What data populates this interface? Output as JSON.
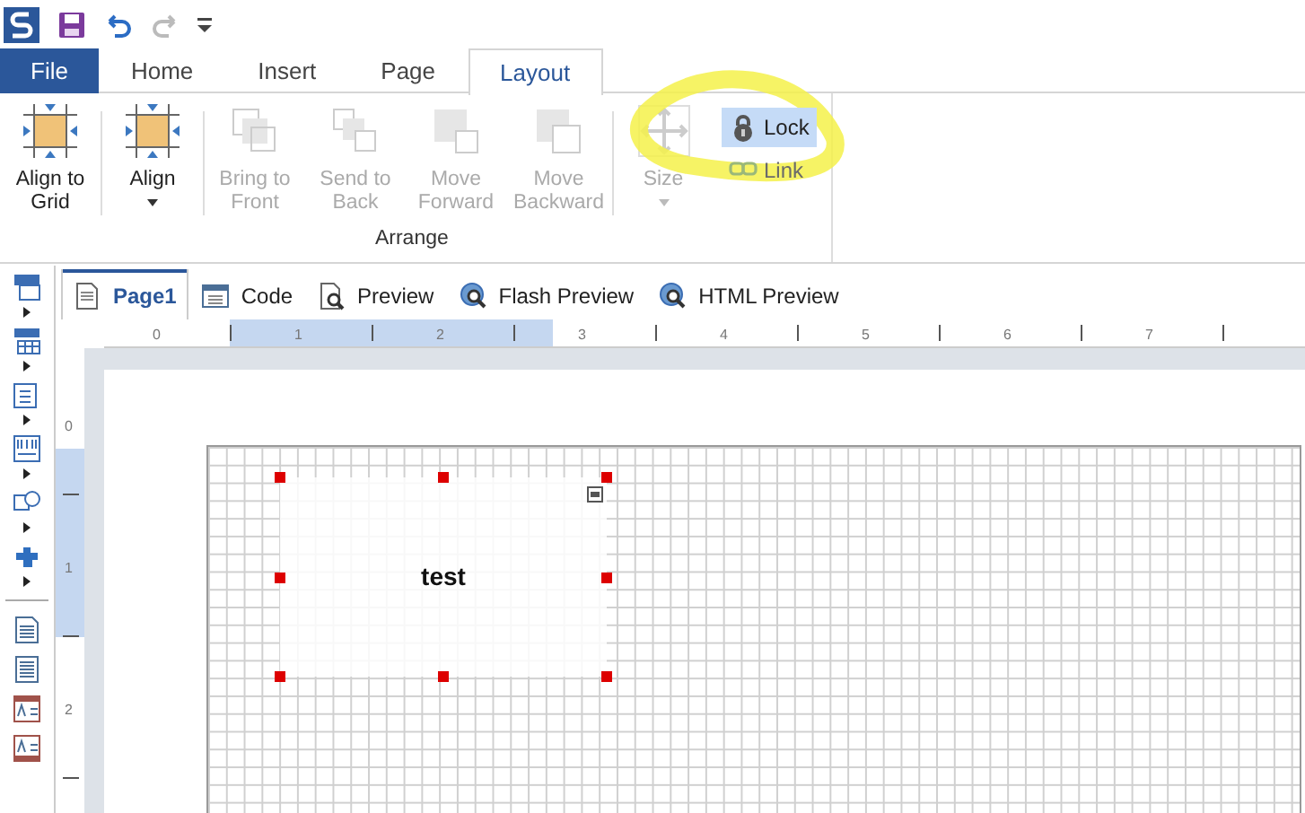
{
  "ribbon_tabs": [
    {
      "label": "File",
      "kind": "file",
      "selected": false
    },
    {
      "label": "Home",
      "kind": "tab",
      "selected": false
    },
    {
      "label": "Insert",
      "kind": "tab",
      "selected": false
    },
    {
      "label": "Page",
      "kind": "tab",
      "selected": false
    },
    {
      "label": "Layout",
      "kind": "tab",
      "selected": true
    }
  ],
  "ribbon": {
    "group_label": "Arrange",
    "buttons": [
      {
        "label": "Align to\nGrid",
        "kind": "align",
        "disabled": false,
        "dropdown": false
      },
      {
        "label": "Align",
        "kind": "align",
        "disabled": false,
        "dropdown": true
      },
      {
        "label": "Bring to\nFront",
        "kind": "front",
        "disabled": true,
        "dropdown": false
      },
      {
        "label": "Send to\nBack",
        "kind": "back",
        "disabled": true,
        "dropdown": false
      },
      {
        "label": "Move\nForward",
        "kind": "forward",
        "disabled": true,
        "dropdown": false
      },
      {
        "label": "Move\nBackward",
        "kind": "backward",
        "disabled": true,
        "dropdown": false
      },
      {
        "label": "Size",
        "kind": "size",
        "disabled": true,
        "dropdown": true
      }
    ],
    "small_buttons": [
      {
        "label": "Lock",
        "kind": "lock",
        "selected": true,
        "disabled": false
      },
      {
        "label": "Link",
        "kind": "link",
        "selected": false,
        "disabled": true
      }
    ]
  },
  "document_tabs": [
    {
      "label": "Page1",
      "kind": "page",
      "selected": true
    },
    {
      "label": "Code",
      "kind": "code",
      "selected": false
    },
    {
      "label": "Preview",
      "kind": "preview",
      "selected": false
    },
    {
      "label": "Flash Preview",
      "kind": "globe",
      "selected": false
    },
    {
      "label": "HTML Preview",
      "kind": "globe",
      "selected": false
    }
  ],
  "horizontal_ruler": [
    "0",
    "1",
    "2",
    "3",
    "4",
    "5",
    "6",
    "7"
  ],
  "vertical_ruler": [
    "0",
    "1",
    "2"
  ],
  "canvas": {
    "text_box": {
      "text": "test",
      "selected": true
    }
  }
}
